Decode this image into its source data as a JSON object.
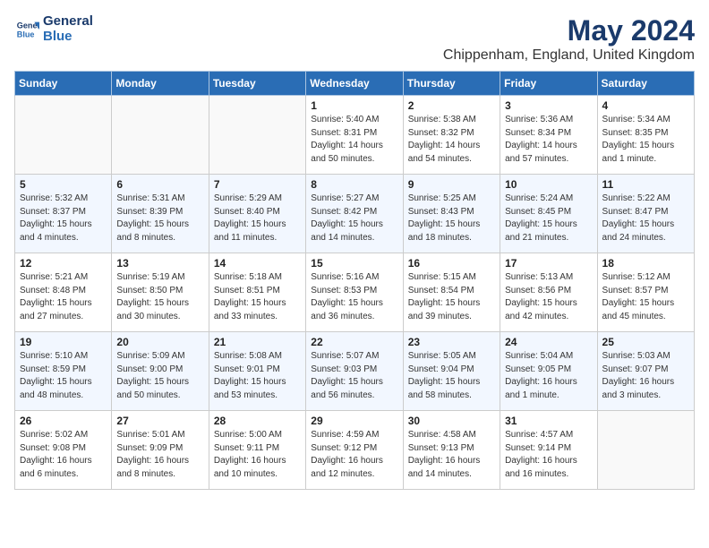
{
  "logo": {
    "line1": "General",
    "line2": "Blue"
  },
  "title": "May 2024",
  "location": "Chippenham, England, United Kingdom",
  "days_of_week": [
    "Sunday",
    "Monday",
    "Tuesday",
    "Wednesday",
    "Thursday",
    "Friday",
    "Saturday"
  ],
  "weeks": [
    [
      {
        "day": "",
        "info": ""
      },
      {
        "day": "",
        "info": ""
      },
      {
        "day": "",
        "info": ""
      },
      {
        "day": "1",
        "info": "Sunrise: 5:40 AM\nSunset: 8:31 PM\nDaylight: 14 hours\nand 50 minutes."
      },
      {
        "day": "2",
        "info": "Sunrise: 5:38 AM\nSunset: 8:32 PM\nDaylight: 14 hours\nand 54 minutes."
      },
      {
        "day": "3",
        "info": "Sunrise: 5:36 AM\nSunset: 8:34 PM\nDaylight: 14 hours\nand 57 minutes."
      },
      {
        "day": "4",
        "info": "Sunrise: 5:34 AM\nSunset: 8:35 PM\nDaylight: 15 hours\nand 1 minute."
      }
    ],
    [
      {
        "day": "5",
        "info": "Sunrise: 5:32 AM\nSunset: 8:37 PM\nDaylight: 15 hours\nand 4 minutes."
      },
      {
        "day": "6",
        "info": "Sunrise: 5:31 AM\nSunset: 8:39 PM\nDaylight: 15 hours\nand 8 minutes."
      },
      {
        "day": "7",
        "info": "Sunrise: 5:29 AM\nSunset: 8:40 PM\nDaylight: 15 hours\nand 11 minutes."
      },
      {
        "day": "8",
        "info": "Sunrise: 5:27 AM\nSunset: 8:42 PM\nDaylight: 15 hours\nand 14 minutes."
      },
      {
        "day": "9",
        "info": "Sunrise: 5:25 AM\nSunset: 8:43 PM\nDaylight: 15 hours\nand 18 minutes."
      },
      {
        "day": "10",
        "info": "Sunrise: 5:24 AM\nSunset: 8:45 PM\nDaylight: 15 hours\nand 21 minutes."
      },
      {
        "day": "11",
        "info": "Sunrise: 5:22 AM\nSunset: 8:47 PM\nDaylight: 15 hours\nand 24 minutes."
      }
    ],
    [
      {
        "day": "12",
        "info": "Sunrise: 5:21 AM\nSunset: 8:48 PM\nDaylight: 15 hours\nand 27 minutes."
      },
      {
        "day": "13",
        "info": "Sunrise: 5:19 AM\nSunset: 8:50 PM\nDaylight: 15 hours\nand 30 minutes."
      },
      {
        "day": "14",
        "info": "Sunrise: 5:18 AM\nSunset: 8:51 PM\nDaylight: 15 hours\nand 33 minutes."
      },
      {
        "day": "15",
        "info": "Sunrise: 5:16 AM\nSunset: 8:53 PM\nDaylight: 15 hours\nand 36 minutes."
      },
      {
        "day": "16",
        "info": "Sunrise: 5:15 AM\nSunset: 8:54 PM\nDaylight: 15 hours\nand 39 minutes."
      },
      {
        "day": "17",
        "info": "Sunrise: 5:13 AM\nSunset: 8:56 PM\nDaylight: 15 hours\nand 42 minutes."
      },
      {
        "day": "18",
        "info": "Sunrise: 5:12 AM\nSunset: 8:57 PM\nDaylight: 15 hours\nand 45 minutes."
      }
    ],
    [
      {
        "day": "19",
        "info": "Sunrise: 5:10 AM\nSunset: 8:59 PM\nDaylight: 15 hours\nand 48 minutes."
      },
      {
        "day": "20",
        "info": "Sunrise: 5:09 AM\nSunset: 9:00 PM\nDaylight: 15 hours\nand 50 minutes."
      },
      {
        "day": "21",
        "info": "Sunrise: 5:08 AM\nSunset: 9:01 PM\nDaylight: 15 hours\nand 53 minutes."
      },
      {
        "day": "22",
        "info": "Sunrise: 5:07 AM\nSunset: 9:03 PM\nDaylight: 15 hours\nand 56 minutes."
      },
      {
        "day": "23",
        "info": "Sunrise: 5:05 AM\nSunset: 9:04 PM\nDaylight: 15 hours\nand 58 minutes."
      },
      {
        "day": "24",
        "info": "Sunrise: 5:04 AM\nSunset: 9:05 PM\nDaylight: 16 hours\nand 1 minute."
      },
      {
        "day": "25",
        "info": "Sunrise: 5:03 AM\nSunset: 9:07 PM\nDaylight: 16 hours\nand 3 minutes."
      }
    ],
    [
      {
        "day": "26",
        "info": "Sunrise: 5:02 AM\nSunset: 9:08 PM\nDaylight: 16 hours\nand 6 minutes."
      },
      {
        "day": "27",
        "info": "Sunrise: 5:01 AM\nSunset: 9:09 PM\nDaylight: 16 hours\nand 8 minutes."
      },
      {
        "day": "28",
        "info": "Sunrise: 5:00 AM\nSunset: 9:11 PM\nDaylight: 16 hours\nand 10 minutes."
      },
      {
        "day": "29",
        "info": "Sunrise: 4:59 AM\nSunset: 9:12 PM\nDaylight: 16 hours\nand 12 minutes."
      },
      {
        "day": "30",
        "info": "Sunrise: 4:58 AM\nSunset: 9:13 PM\nDaylight: 16 hours\nand 14 minutes."
      },
      {
        "day": "31",
        "info": "Sunrise: 4:57 AM\nSunset: 9:14 PM\nDaylight: 16 hours\nand 16 minutes."
      },
      {
        "day": "",
        "info": ""
      }
    ]
  ]
}
